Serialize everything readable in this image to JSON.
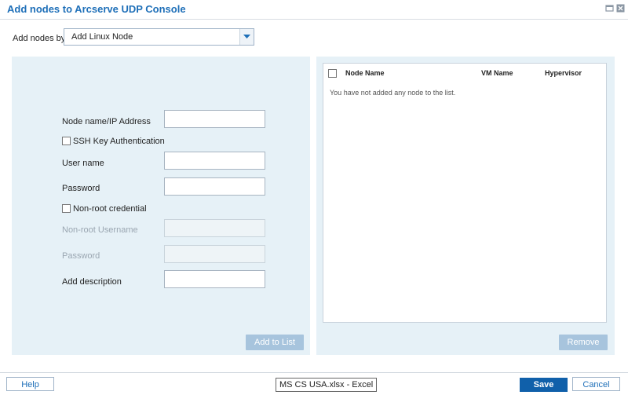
{
  "dialog": {
    "title": "Add nodes to Arcserve UDP Console",
    "add_nodes_by_label": "Add nodes by",
    "add_nodes_by_value": "Add Linux Node"
  },
  "form": {
    "node_label": "Node name/IP Address",
    "ssh_label": "SSH Key Authentication",
    "user_label": "User name",
    "password_label": "Password",
    "nonroot_check_label": "Non-root credential",
    "nonroot_user_label": "Non-root Username",
    "nonroot_password_label": "Password",
    "description_label": "Add description",
    "add_to_list": "Add to List"
  },
  "grid": {
    "columns": [
      "Node Name",
      "VM Name",
      "Hypervisor"
    ],
    "empty_message": "You have not added any node to the list.",
    "remove": "Remove"
  },
  "footer": {
    "help": "Help",
    "save": "Save",
    "cancel": "Cancel"
  },
  "tooltip": "MS CS USA.xlsx - Excel",
  "colors": {
    "title": "#1e6fb8",
    "panel_bg": "#e6f1f7",
    "primary_button": "#1060aa",
    "disabled_button": "#a7c4dd"
  }
}
